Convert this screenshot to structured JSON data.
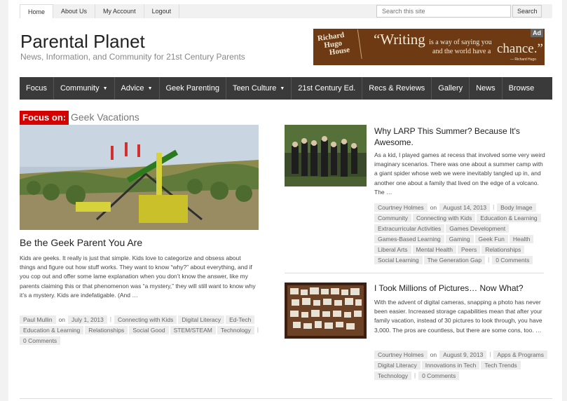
{
  "top_nav": {
    "items": [
      "Home",
      "About Us",
      "My Account",
      "Logout"
    ]
  },
  "search": {
    "placeholder": "Search this site",
    "button": "Search"
  },
  "site": {
    "title": "Parental Planet",
    "tagline": "News, Information, and Community for 21st Century Parents"
  },
  "ad": {
    "badge": "Ad",
    "brand_lines": [
      "Richard",
      "Hugo",
      "House"
    ],
    "quote_part1": "“Writing",
    "quote_part2": "is a way of saying you",
    "quote_part3": "and the world have a",
    "quote_part4": "chance.”",
    "attribution": "— Richard Hugo"
  },
  "main_nav": {
    "items": [
      {
        "label": "Focus",
        "dropdown": false
      },
      {
        "label": "Community",
        "dropdown": true
      },
      {
        "label": "Advice",
        "dropdown": true
      },
      {
        "label": "Geek Parenting",
        "dropdown": false
      },
      {
        "label": "Teen Culture",
        "dropdown": true
      },
      {
        "label": "21st Century Ed.",
        "dropdown": false
      },
      {
        "label": "Recs & Reviews",
        "dropdown": false
      },
      {
        "label": "Gallery",
        "dropdown": false
      },
      {
        "label": "News",
        "dropdown": false
      },
      {
        "label": "Browse",
        "dropdown": false
      }
    ]
  },
  "focus": {
    "label": "Focus on:",
    "topic": "Geek Vacations"
  },
  "featured": {
    "title": "Be the Geek Parent You Are",
    "excerpt": "Kids are geeks. It really is just that simple. Kids love to categorize and obsess about things and figure out how stuff works. They want to know “why?” about everything, and if you cop out and offer some lame explanation when you don’t know the answer, like my parents claiming this or that phenomenon was “a mystery,” they will still want to know why it’s a mystery. Kids are indefatigable. (And …",
    "author": "Paul Mullin",
    "on": "on",
    "date": "July 1, 2013",
    "tags": [
      "Connecting with Kids",
      "Digital Literacy",
      "Ed-Tech",
      "Education & Learning",
      "Relationships",
      "Social Good",
      "STEM/STEAM",
      "Technology"
    ],
    "comments": "0 Comments"
  },
  "posts": [
    {
      "title": "Why LARP This Summer? Because It's Awesome.",
      "excerpt": "As a kid, I played games at recess that involved some very weird imaginary scenarios. There was one about a summer camp with a giant spider whose web we were inevitably tangled up in, and another one about a family that lived on the edge of a volcano.  The …",
      "author": "Courtney Holmes",
      "on": "on",
      "date": "August 14, 2013",
      "tags": [
        "Body Image",
        "Community",
        "Connecting with Kids",
        "Education & Learning",
        "Extracurricular Activities",
        "Games Development",
        "Games-Based Learning",
        "Gaming",
        "Geek Fun",
        "Health",
        "Liberal Arts",
        "Mental Health",
        "Peers",
        "Relationships",
        "Social Learning",
        "The Generation Gap"
      ],
      "comments": "0 Comments"
    },
    {
      "title": "I Took Millions of Pictures… Now What?",
      "excerpt": "With the advent of digital cameras, snapping a photo has never been easier. Increased storage capabilities mean that after your family vacation, instead of 30 pictures to look through, you have 3,000. The pros are countless, but there are some cons, too. …",
      "author": "Courtney Holmes",
      "on": "on",
      "date": "August 9, 2013",
      "tags": [
        "Apps & Programs",
        "Digital Literacy",
        "Innovations in Tech",
        "Tech Trends",
        "Technology"
      ],
      "comments": "0 Comments"
    }
  ],
  "colors": {
    "focus_red": "#d40000",
    "nav_dark": "#3a3a3a",
    "ad_brown": "#6e3a13"
  }
}
